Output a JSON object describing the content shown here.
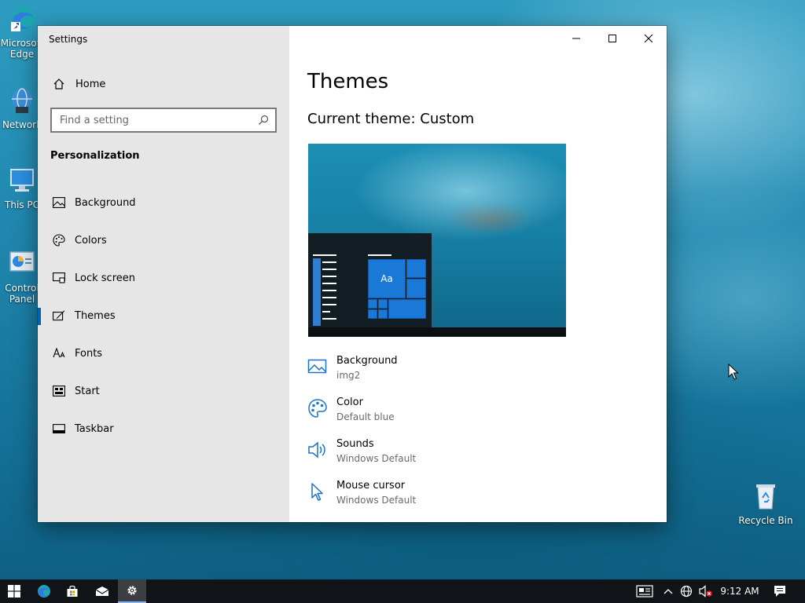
{
  "desktop": {
    "icons": [
      {
        "label": "Microsoft Edge"
      },
      {
        "label": "Network"
      },
      {
        "label": "This PC"
      },
      {
        "label": "Control Panel"
      },
      {
        "label": "Recycle Bin"
      }
    ]
  },
  "window": {
    "title": "Settings"
  },
  "sidebar": {
    "home_label": "Home",
    "search_placeholder": "Find a setting",
    "section_title": "Personalization",
    "items": [
      {
        "label": "Background",
        "icon": "image-icon"
      },
      {
        "label": "Colors",
        "icon": "palette-icon"
      },
      {
        "label": "Lock screen",
        "icon": "lock-screen-icon"
      },
      {
        "label": "Themes",
        "icon": "brush-icon",
        "selected": true
      },
      {
        "label": "Fonts",
        "icon": "font-icon"
      },
      {
        "label": "Start",
        "icon": "start-icon"
      },
      {
        "label": "Taskbar",
        "icon": "taskbar-icon"
      }
    ]
  },
  "main": {
    "title": "Themes",
    "current_theme": "Current theme: Custom",
    "preview_tile_label": "Aa",
    "properties": [
      {
        "name": "Background",
        "value": "img2",
        "icon": "image-icon"
      },
      {
        "name": "Color",
        "value": "Default blue",
        "icon": "palette-icon"
      },
      {
        "name": "Sounds",
        "value": "Windows Default",
        "icon": "speaker-icon"
      },
      {
        "name": "Mouse cursor",
        "value": "Windows Default",
        "icon": "cursor-icon"
      }
    ]
  },
  "taskbar": {
    "clock": "9:12 AM"
  },
  "colors": {
    "accent": "#0063b1",
    "icon_blue": "#1a73c9",
    "sidebar_bg": "#e6e6e6",
    "taskbar_bg": "#101418"
  }
}
